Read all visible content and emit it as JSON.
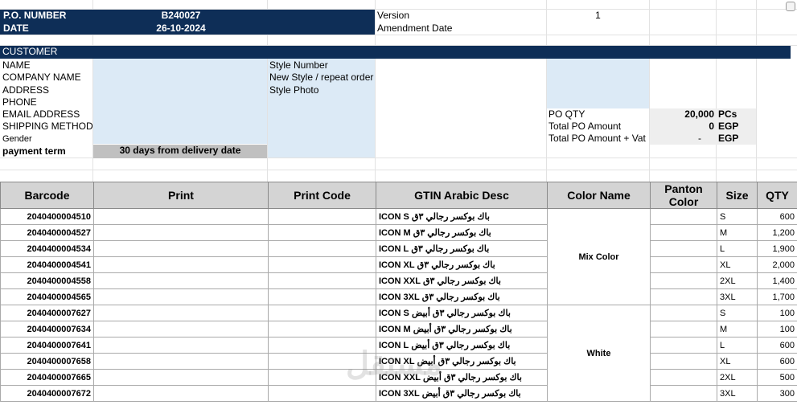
{
  "header": {
    "po_number_label": "P.O. NUMBER",
    "po_number_value": "B240027",
    "date_label": "DATE",
    "date_value": "26-10-2024",
    "version_label": "Version",
    "version_value": "1",
    "amendment_label": "Amendment Date"
  },
  "customer": {
    "section_label": "CUSTOMER",
    "fields": [
      "NAME",
      "COMPANY NAME",
      "ADDRESS",
      "PHONE",
      "EMAIL ADDRESS",
      "SHIPPING METHOD",
      "Gender"
    ],
    "payment_term_label": "payment term",
    "payment_term_value": "30 days from delivery date"
  },
  "style": {
    "fields": [
      "Style Number",
      "New Style / repeat order",
      "Style Photo"
    ]
  },
  "totals": {
    "po_qty_label": "PO QTY",
    "po_qty_value": "20,000",
    "po_qty_unit": "PCs",
    "total_amount_label": "Total PO Amount",
    "total_amount_value": "0",
    "total_amount_unit": "EGP",
    "total_vat_label": "Total PO Amount + Vat",
    "total_vat_value": "-",
    "total_vat_unit": "EGP"
  },
  "table": {
    "headers": {
      "barcode": "Barcode",
      "print": "Print",
      "print_code": "Print Code",
      "gtin": "GTIN Arabic Desc",
      "color_name": "Color Name",
      "panton": "Panton Color",
      "size": "Size",
      "qty": "QTY"
    },
    "groups": [
      {
        "color": "Mix Color",
        "rows": [
          {
            "barcode": "2040400004510",
            "gtin": "باك بوكسر رجالي ٣ق ICON S",
            "size": "S",
            "qty": "600"
          },
          {
            "barcode": "2040400004527",
            "gtin": "باك بوكسر رجالي ٣ق ICON M",
            "size": "M",
            "qty": "1,200"
          },
          {
            "barcode": "2040400004534",
            "gtin": "باك بوكسر رجالي ٣ق ICON L",
            "size": "L",
            "qty": "1,900"
          },
          {
            "barcode": "2040400004541",
            "gtin": "باك بوكسر رجالي ٣ق ICON XL",
            "size": "XL",
            "qty": "2,000"
          },
          {
            "barcode": "2040400004558",
            "gtin": "باك بوكسر رجالي ٣ق ICON XXL",
            "size": "2XL",
            "qty": "1,400"
          },
          {
            "barcode": "2040400004565",
            "gtin": "باك بوكسر رجالي ٣ق ICON 3XL",
            "size": "3XL",
            "qty": "1,700"
          }
        ]
      },
      {
        "color": "White",
        "rows": [
          {
            "barcode": "2040400007627",
            "gtin": "باك بوكسر رجالي ٣ق أبيض ICON S",
            "size": "S",
            "qty": "100"
          },
          {
            "barcode": "2040400007634",
            "gtin": "باك بوكسر رجالي ٣ق أبيض ICON M",
            "size": "M",
            "qty": "100"
          },
          {
            "barcode": "2040400007641",
            "gtin": "باك بوكسر رجالي ٣ق أبيض ICON L",
            "size": "L",
            "qty": "600"
          },
          {
            "barcode": "2040400007658",
            "gtin": "باك بوكسر رجالي ٣ق أبيض ICON XL",
            "size": "XL",
            "qty": "600"
          },
          {
            "barcode": "2040400007665",
            "gtin": "باك بوكسر رجالي ٣ق أبيض ICON XXL",
            "size": "2XL",
            "qty": "500"
          },
          {
            "barcode": "2040400007672",
            "gtin": "باك بوكسر رجالي ٣ق أبيض ICON 3XL",
            "size": "3XL",
            "qty": "300"
          }
        ]
      }
    ]
  },
  "colors": {
    "navy": "#0e2e57",
    "light_blue": "#dceaf6",
    "header_gray": "#d4d4d4",
    "term_gray": "#c0c0c0"
  },
  "watermark": "مستقل"
}
